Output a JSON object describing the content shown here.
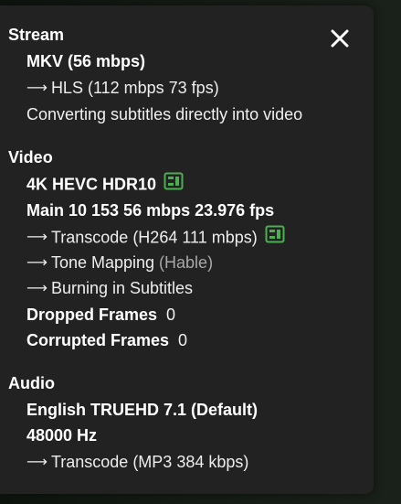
{
  "stream": {
    "title": "Stream",
    "container": "MKV (56 mbps)",
    "transcode": "HLS (112 mbps 73 fps)",
    "subtitle_note": "Converting subtitles directly into video"
  },
  "video": {
    "title": "Video",
    "format": "4K HEVC HDR10",
    "profile": "Main 10 153 56 mbps 23.976 fps",
    "transcode": "Transcode (H264 111 mbps)",
    "tone_mapping_label": "Tone Mapping",
    "tone_mapping_value": "(Hable)",
    "burning": "Burning in Subtitles",
    "dropped_label": "Dropped Frames",
    "dropped_value": "0",
    "corrupted_label": "Corrupted Frames",
    "corrupted_value": "0"
  },
  "audio": {
    "title": "Audio",
    "track": "English TRUEHD 7.1 (Default)",
    "sample_rate": "48000 Hz",
    "transcode": "Transcode (MP3 384 kbps)"
  },
  "arrow_glyph": "⟶",
  "colors": {
    "panel_bg": "#222222",
    "hw_accel_icon": "#4caf50",
    "dim_text": "#a8a8a8"
  },
  "icons": {
    "close": "close-icon",
    "hardware": "hardware-acceleration-icon"
  }
}
